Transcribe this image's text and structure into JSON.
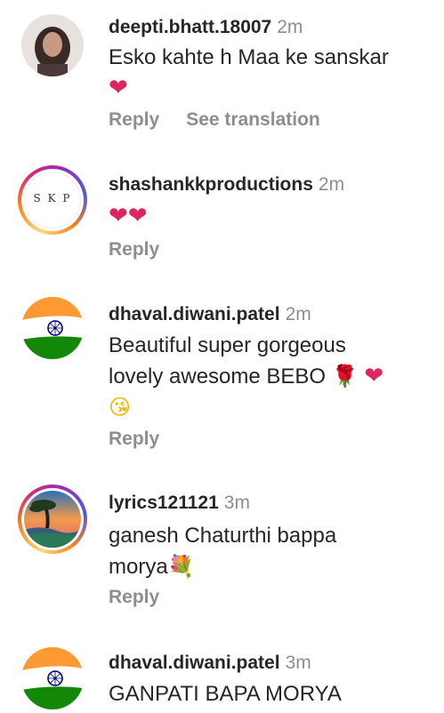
{
  "comments": [
    {
      "username": "deepti.bhatt.18007",
      "time": "2m",
      "text": "Esko kahte h Maa ke sanskar",
      "emoji": "❤",
      "reply": "Reply",
      "translate": "See translation"
    },
    {
      "username": "shashankkproductions",
      "time": "2m",
      "text": "",
      "emoji": "❤❤",
      "reply": "Reply",
      "avatar_text": "S K P"
    },
    {
      "username": "dhaval.diwani.patel",
      "time": "2m",
      "text_line1": "Beautiful super gorgeous",
      "text_line2": "lovely awesome BEBO",
      "emoji_rose": "🌹",
      "emoji_heart": "❤",
      "emoji_kiss": "😘",
      "reply": "Reply"
    },
    {
      "username": "lyrics121121",
      "time": "3m",
      "text_line1": "ganesh Chaturthi bappa",
      "text_line2": "morya",
      "emoji": "💐",
      "reply": "Reply"
    },
    {
      "username": "dhaval.diwani.patel",
      "time": "3m",
      "text": "GANPATI BAPA MORYA"
    }
  ],
  "colors": {
    "text": "#262626",
    "muted": "#8e8e8e",
    "heart": "#e0245e",
    "saffron": "#ff9933",
    "green": "#138808",
    "chakra": "#000080"
  }
}
